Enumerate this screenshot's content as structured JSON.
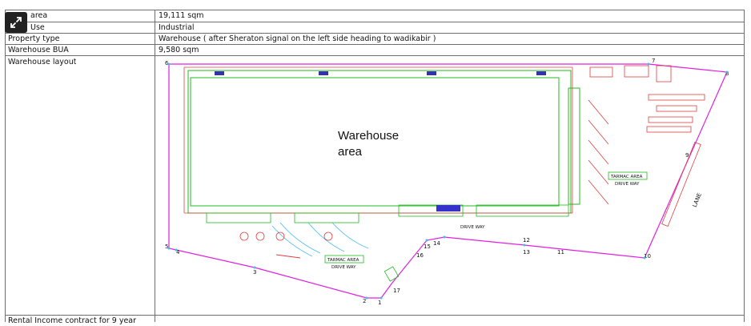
{
  "rows": [
    {
      "label": "area",
      "value": "19,111 sqm"
    },
    {
      "label": "Use",
      "value": "Industrial"
    },
    {
      "label": "Property type",
      "value": "Warehouse ( after Sheraton signal on the left side heading to wadikabir )"
    },
    {
      "label": "Warehouse BUA",
      "value": "9,580 sqm"
    },
    {
      "label": "Warehouse layout",
      "value": ""
    },
    {
      "label": "Rental Income contract for 9 year",
      "value": ""
    }
  ],
  "expand_icon": "expand-arrows-icon",
  "plan": {
    "main_area": [
      "Warehouse",
      "area"
    ],
    "tarmac_right": [
      "TARMAC AREA",
      "DRIVE WAY"
    ],
    "tarmac_bottom": [
      "TARMAC AREA",
      "DRIVE WAY"
    ],
    "drive_way": "DRIVE WAY",
    "lane": "LANE",
    "point_numbers": [
      "1",
      "2",
      "3",
      "4",
      "5",
      "6",
      "7",
      "8",
      "9",
      "10",
      "11",
      "12",
      "13",
      "14",
      "15",
      "16",
      "17"
    ]
  },
  "colors": {
    "boundary": "#e020e0",
    "building": "#22bb22",
    "structure": "#e04040",
    "annotation": "#3333aa",
    "tarmac": "#44bbee"
  }
}
